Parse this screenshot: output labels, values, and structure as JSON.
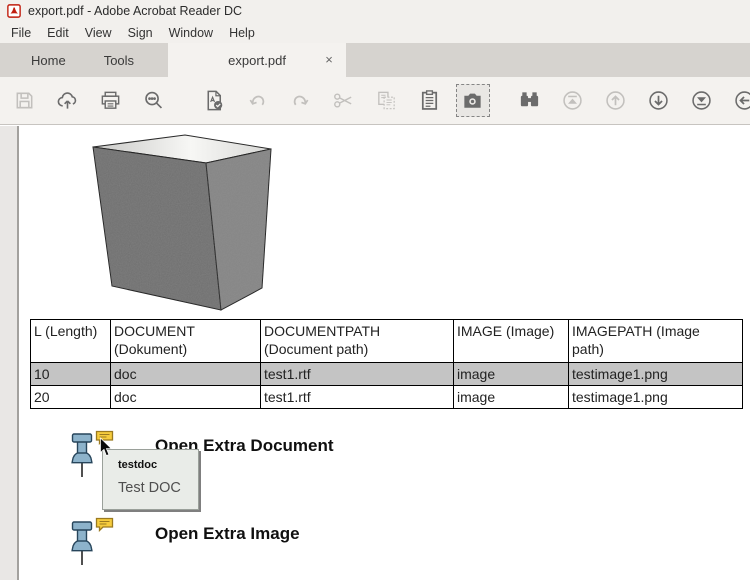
{
  "window": {
    "title": "export.pdf - Adobe Acrobat Reader DC"
  },
  "menubar": {
    "items": [
      "File",
      "Edit",
      "View",
      "Sign",
      "Window",
      "Help"
    ]
  },
  "tabbar": {
    "home": "Home",
    "tools": "Tools",
    "document_tab": "export.pdf",
    "close": "×"
  },
  "toolbar": {
    "icons": [
      {
        "name": "save",
        "state": "disabled"
      },
      {
        "name": "share-cloud",
        "state": "normal"
      },
      {
        "name": "print",
        "state": "normal"
      },
      {
        "name": "search",
        "state": "normal"
      },
      {
        "name": "export-pdf",
        "state": "normal"
      },
      {
        "name": "undo",
        "state": "disabled"
      },
      {
        "name": "redo",
        "state": "disabled"
      },
      {
        "name": "cut",
        "state": "disabled"
      },
      {
        "name": "copy",
        "state": "disabled"
      },
      {
        "name": "paste",
        "state": "normal"
      },
      {
        "name": "snapshot",
        "state": "selected"
      },
      {
        "name": "binoculars",
        "state": "normal"
      },
      {
        "name": "first-page",
        "state": "disabled"
      },
      {
        "name": "previous-page",
        "state": "disabled"
      },
      {
        "name": "next-page",
        "state": "normal"
      },
      {
        "name": "last-page",
        "state": "normal"
      },
      {
        "name": "previous-view",
        "state": "normal"
      }
    ]
  },
  "document": {
    "table": {
      "columns": [
        "L (Length)",
        "DOCUMENT (Dokument)",
        "DOCUMENTPATH (Document path)",
        "IMAGE (Image)",
        "IMAGEPATH (Image path)"
      ],
      "rows": [
        {
          "cells": [
            "10",
            "doc",
            "test1.rtf",
            "image",
            "testimage1.png"
          ],
          "highlighted": true
        },
        {
          "cells": [
            "20",
            "doc",
            "test1.rtf",
            "image",
            "testimage1.png"
          ],
          "highlighted": false
        }
      ]
    },
    "attachments": [
      {
        "label": "Open Extra Document"
      },
      {
        "label": "Open Extra Image"
      }
    ],
    "tooltip": {
      "title": "testdoc",
      "body": "Test DOC"
    }
  },
  "colors": {
    "accent_red": "#c11e0f",
    "toolbar_bg": "#f4f2ef",
    "tabbar_bg": "#d6d3cf",
    "row_highlight": "#c4c4c4",
    "pin_fill": "#8db3cb",
    "note_yellow": "#f6cc3e",
    "tooltip_bg": "#e9ece8"
  }
}
